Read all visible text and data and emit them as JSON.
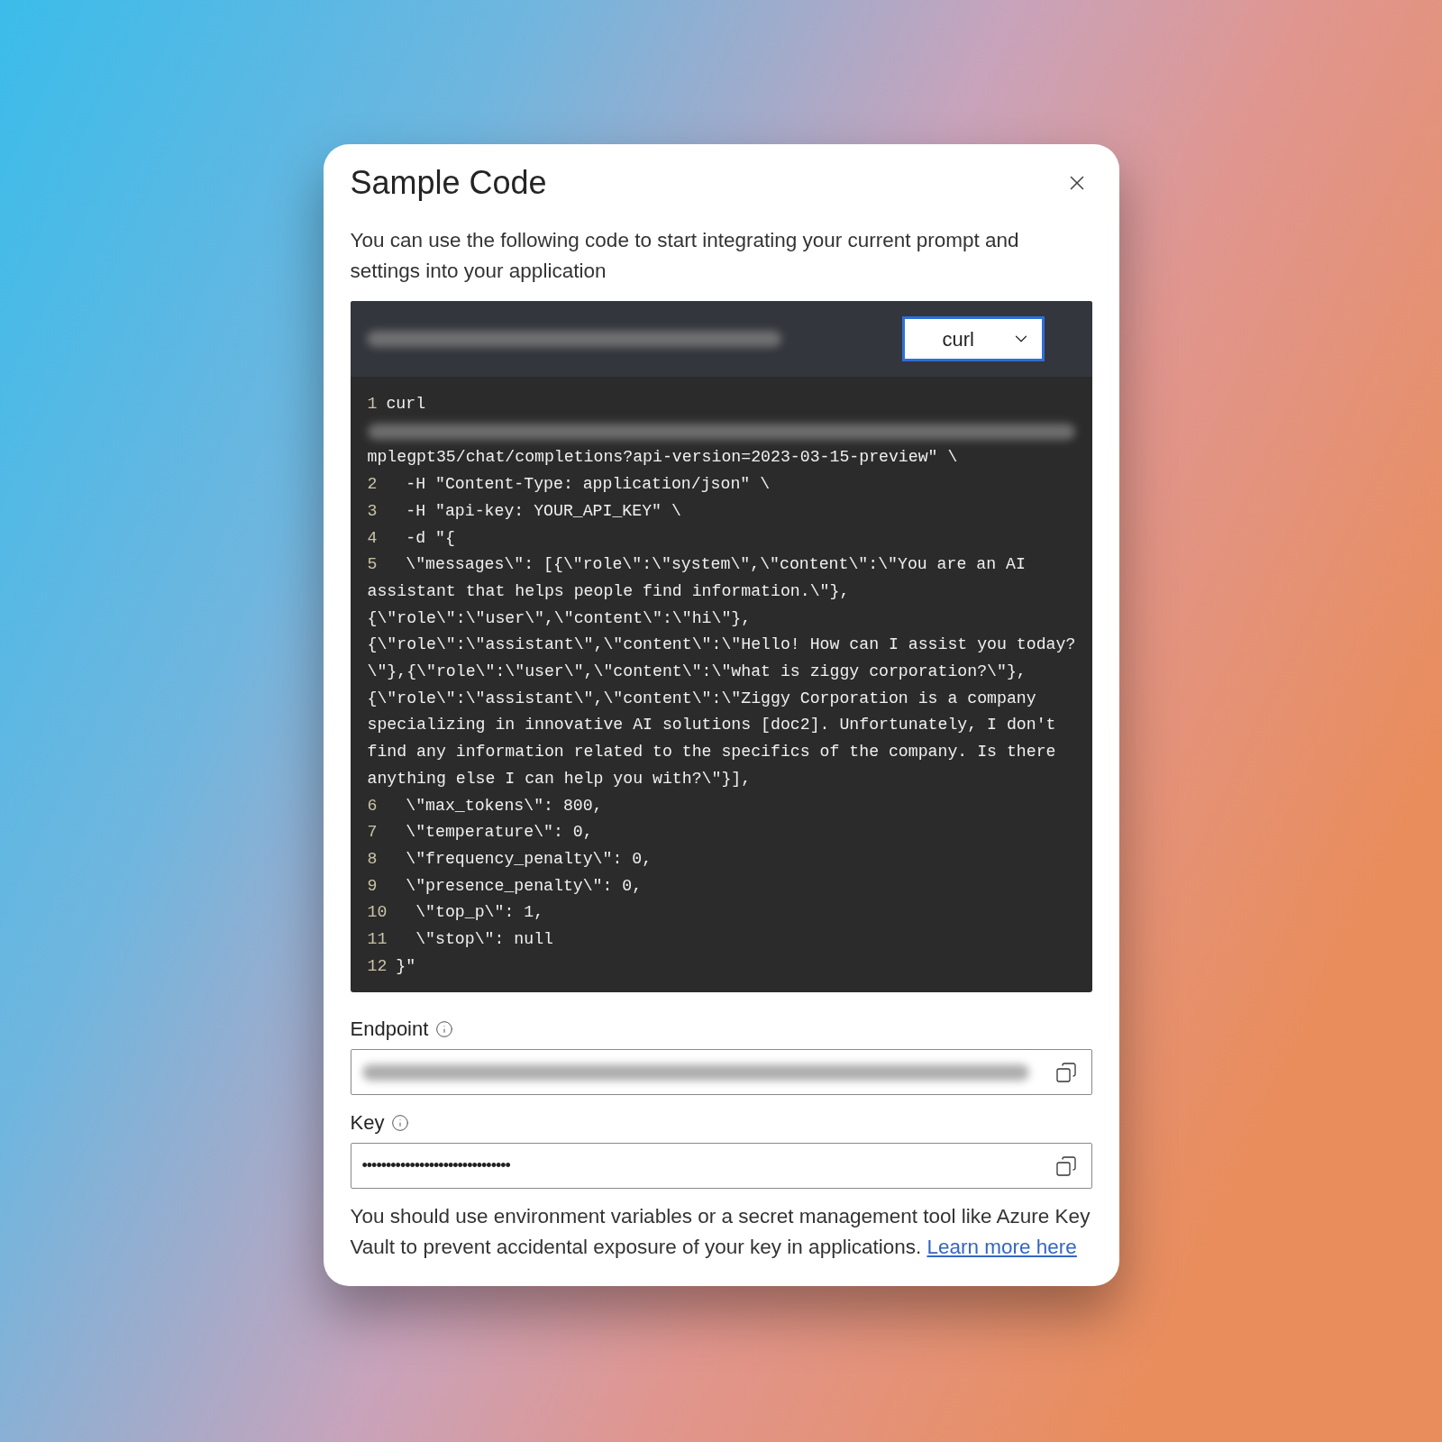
{
  "dialog": {
    "title": "Sample Code",
    "description": "You can use the following code to start integrating your current prompt and settings into your application",
    "code_panel": {
      "language_select": {
        "value": "curl"
      },
      "lines": [
        {
          "kind": "code",
          "number": "1",
          "text": "curl"
        },
        {
          "kind": "redacted"
        },
        {
          "kind": "code",
          "text": "mplegpt35/chat/completions?api-version=2023-03-15-preview\" \\"
        },
        {
          "kind": "code",
          "number": "2",
          "text": "  -H \"Content-Type: application/json\" \\"
        },
        {
          "kind": "code",
          "number": "3",
          "text": "  -H \"api-key: YOUR_API_KEY\" \\"
        },
        {
          "kind": "code",
          "number": "4",
          "text": "  -d \"{"
        },
        {
          "kind": "code",
          "number": "5",
          "text": "  \\\"messages\\\": [{\\\"role\\\":\\\"system\\\",\\\"content\\\":\\\"You are an AI"
        },
        {
          "kind": "code",
          "text": "assistant that helps people find information.\\\"},"
        },
        {
          "kind": "code",
          "text": "{\\\"role\\\":\\\"user\\\",\\\"content\\\":\\\"hi\\\"},"
        },
        {
          "kind": "code",
          "text": "{\\\"role\\\":\\\"assistant\\\",\\\"content\\\":\\\"Hello! How can I assist you today?"
        },
        {
          "kind": "code",
          "text": "\\\"},{\\\"role\\\":\\\"user\\\",\\\"content\\\":\\\"what is ziggy corporation?\\\"},"
        },
        {
          "kind": "code",
          "text": "{\\\"role\\\":\\\"assistant\\\",\\\"content\\\":\\\"Ziggy Corporation is a company"
        },
        {
          "kind": "code",
          "text": "specializing in innovative AI solutions [doc2]. Unfortunately, I don't"
        },
        {
          "kind": "code",
          "text": "find any information related to the specifics of the company. Is there"
        },
        {
          "kind": "code",
          "text": "anything else I can help you with?\\\"}],"
        },
        {
          "kind": "code",
          "number": "6",
          "text": "  \\\"max_tokens\\\": 800,"
        },
        {
          "kind": "code",
          "number": "7",
          "text": "  \\\"temperature\\\": 0,"
        },
        {
          "kind": "code",
          "number": "8",
          "text": "  \\\"frequency_penalty\\\": 0,"
        },
        {
          "kind": "code",
          "number": "9",
          "text": "  \\\"presence_penalty\\\": 0,"
        },
        {
          "kind": "code",
          "number": "10",
          "text": "  \\\"top_p\\\": 1,"
        },
        {
          "kind": "code",
          "number": "11",
          "text": "  \\\"stop\\\": null"
        },
        {
          "kind": "code",
          "number": "12",
          "text": "}\""
        }
      ]
    },
    "fields": [
      {
        "label": "Endpoint",
        "kind": "redacted"
      },
      {
        "label": "Key",
        "kind": "password",
        "value": "•••••••••••••••••••••••••••••••"
      }
    ],
    "footer": {
      "text": "You should use environment variables or a secret management tool like Azure Key Vault to prevent accidental exposure of your key in applications.",
      "link": "Learn more here"
    }
  }
}
